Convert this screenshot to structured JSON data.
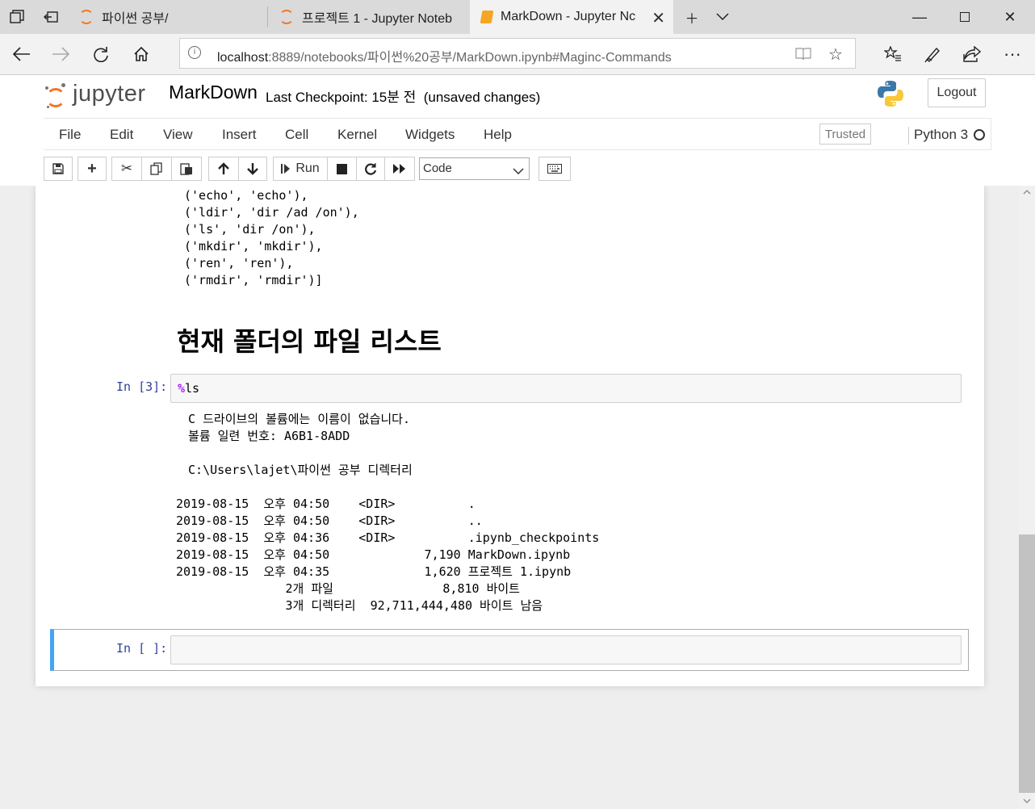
{
  "browser": {
    "tabs": [
      {
        "label": "파이썬 공부/"
      },
      {
        "label": "프로젝트 1 - Jupyter Noteb"
      },
      {
        "label": "MarkDown - Jupyter Nc"
      }
    ],
    "url_host": "localhost",
    "url_rest": ":8889/notebooks/파이썬%20공부/MarkDown.ipynb#Maginc-Commands"
  },
  "header": {
    "logo_text": "jupyter",
    "notebook_title": "MarkDown",
    "checkpoint": "Last Checkpoint: 15분 전",
    "unsaved": "(unsaved changes)",
    "logout_label": "Logout"
  },
  "menubar": {
    "items": [
      "File",
      "Edit",
      "View",
      "Insert",
      "Cell",
      "Kernel",
      "Widgets",
      "Help"
    ],
    "trusted": "Trusted",
    "kernel": "Python 3"
  },
  "toolbar": {
    "run_label": "Run",
    "cell_type": "Code"
  },
  "notebook": {
    "prev_output": [
      "('echo', 'echo'),",
      "('ldir', 'dir /ad /on'),",
      "('ls', 'dir /on'),",
      "('mkdir', 'mkdir'),",
      "('ren', 'ren'),",
      "('rmdir', 'rmdir')]"
    ],
    "heading": "현재 폴더의 파일 리스트",
    "cell3": {
      "prompt": "In [3]:",
      "magic": "%",
      "code": "ls",
      "output_header": [
        " C 드라이브의 볼륨에는 이름이 없습니다.",
        " 볼륨 일련 번호: A6B1-8ADD",
        "",
        " C:\\Users\\lajet\\파이썬 공부 디렉터리",
        ""
      ],
      "output_rows": [
        "2019-08-15  오후 04:50    <DIR>          .",
        "2019-08-15  오후 04:50    <DIR>          ..",
        "2019-08-15  오후 04:36    <DIR>          .ipynb_checkpoints",
        "2019-08-15  오후 04:50             7,190 MarkDown.ipynb",
        "2019-08-15  오후 04:35             1,620 프로젝트 1.ipynb",
        "               2개 파일               8,810 바이트",
        "               3개 디렉터리  92,711,444,480 바이트 남음"
      ]
    },
    "empty_cell": {
      "prompt": "In [ ]:"
    }
  }
}
